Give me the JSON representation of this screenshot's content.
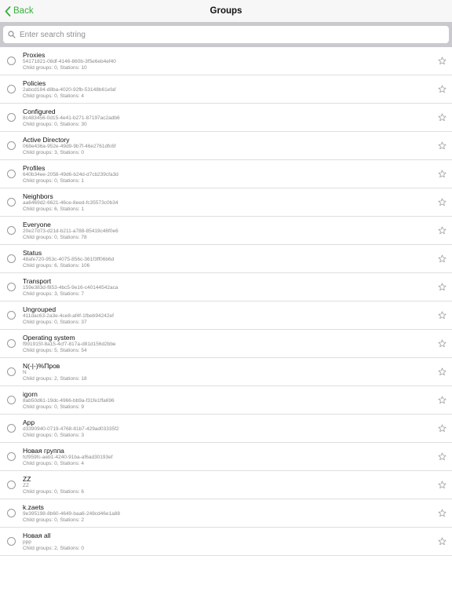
{
  "nav": {
    "back_label": "Back",
    "title": "Groups"
  },
  "search": {
    "placeholder": "Enter search string",
    "value": ""
  },
  "colors": {
    "accent": "#36b03b",
    "searchbar_bg": "#c9c9ce",
    "separator": "#dedede"
  },
  "groups": [
    {
      "name": "Proxies",
      "uid": "54171821-08df-4146-860b-3f5e6eb4ef40",
      "counts": "Child groups: 0, Stations: 10"
    },
    {
      "name": "Policies",
      "uid": "2abcd184-d8ba-4020-92fb-53148b61efaf",
      "counts": "Child groups: 0, Stations: 4"
    },
    {
      "name": "Configured",
      "uid": "8c483456-0d15-4e41-b271-87197ac2adb6",
      "counts": "Child groups: 0, Stations: 30"
    },
    {
      "name": "Active Directory",
      "uid": "068e436a-952e-49d9-9b7f-46e2761dfc6f",
      "counts": "Child groups: 3, Stations: 0"
    },
    {
      "name": "Profiles",
      "uid": "640b34ee-2058-49d6-b24d-d7cb239cfa3d",
      "counts": "Child groups: 0, Stations: 1"
    },
    {
      "name": "Neighbors",
      "uid": "aa6469d2-6621-46ce-8eed-fc35573c0b34",
      "counts": "Child groups: 6, Stations: 1"
    },
    {
      "name": "Everyone",
      "uid": "20e27d73-d21d-b211-a788-85419c46f0e6",
      "counts": "Child groups: 0, Stations: 78"
    },
    {
      "name": "Status",
      "uid": "48afe720-953c-4075-856c-361f3ff06b6d",
      "counts": "Child groups: 6, Stations: 106"
    },
    {
      "name": "Transport",
      "uid": "159e383d-f853-4bc5-9e16-c40144542aca",
      "counts": "Child groups: 3, Stations: 7"
    },
    {
      "name": "Ungrouped",
      "uid": "411dac63-2a3e-4ce8-af4f-1fbeb94242ef",
      "counts": "Child groups: 0, Stations: 37"
    },
    {
      "name": "Operating system",
      "uid": "f991915f-8a15-4cf7-817a-d81d156d2bbe",
      "counts": "Child groups: 5, Stations: 54"
    },
    {
      "name": "N(-|-)%Пров",
      "uid": "N",
      "counts": "Child groups: 2, Stations: 18"
    },
    {
      "name": "igorn",
      "uid": "8ab50d61-19dc-4966-bb9a-f31fe1ffa696",
      "counts": "Child groups: 0, Stations: 9"
    },
    {
      "name": "App",
      "uid": "d3390940-0719-4768-81b7-429ad03335f2",
      "counts": "Child groups: 0, Stations: 3"
    },
    {
      "name": "Новая группа",
      "uid": "fcf959fc-aeb1-4240-91ba-af6ad30193ef",
      "counts": "Child groups: 0, Stations: 4"
    },
    {
      "name": "ZZ",
      "uid": "ZZ",
      "counts": "Child groups: 0, Stations: 6"
    },
    {
      "name": "k.zaets",
      "uid": "9e395198-8b60-4649-baa6-248cd46e1a88",
      "counts": "Child groups: 0, Stations: 2"
    },
    {
      "name": "Новая all",
      "uid": "ppp",
      "counts": "Child groups: 2, Stations: 0"
    }
  ]
}
